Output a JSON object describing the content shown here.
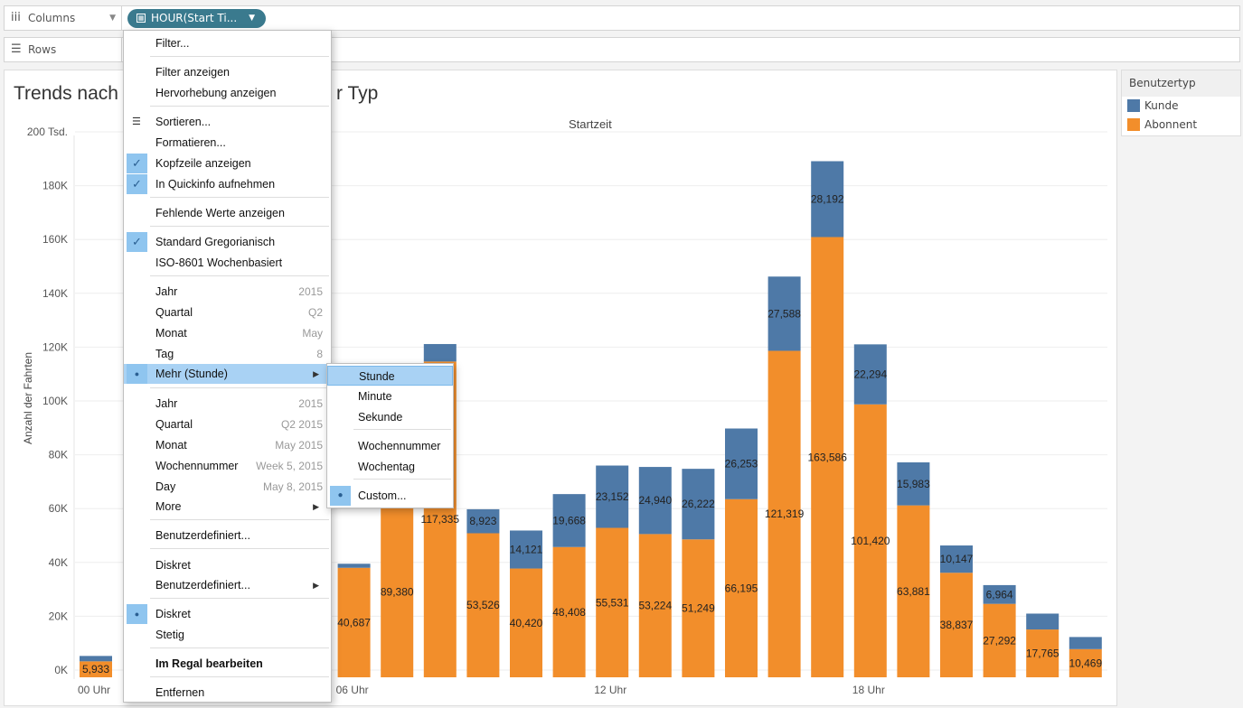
{
  "shelves": {
    "columns_label": "Columns",
    "rows_label": "Rows",
    "pill_label": "HOUR(Start Ti..."
  },
  "view": {
    "title_left": "Trends nach",
    "title_right": "r Typ",
    "header": "Startzeit"
  },
  "legend": {
    "title": "Benutzertyp",
    "items": [
      {
        "label": "Kunde",
        "color": "#4e79a7"
      },
      {
        "label": "Abonnent",
        "color": "#f28e2b"
      }
    ]
  },
  "menu": {
    "items": [
      {
        "label": "Filter..."
      },
      {
        "label": "Filter anzeigen"
      },
      {
        "label": "Hervorhebung anzeigen"
      },
      {
        "label": "Sortieren...",
        "icon": "sort-icon"
      },
      {
        "label": "Formatieren..."
      },
      {
        "label": "Kopfzeile anzeigen",
        "checked": true
      },
      {
        "label": "In Quickinfo aufnehmen",
        "checked": true
      },
      {
        "label": "Fehlende Werte anzeigen"
      },
      {
        "label": "Standard Gregorianisch",
        "checked": true
      },
      {
        "label": "ISO-8601 Wochenbasiert"
      },
      {
        "label": "Jahr",
        "value": "2015"
      },
      {
        "label": "Quartal",
        "value": "Q2"
      },
      {
        "label": "Monat",
        "value": "May"
      },
      {
        "label": "Tag",
        "value": "8"
      },
      {
        "label": "Mehr (Stunde)",
        "bullet": true,
        "submenu": true
      },
      {
        "label": "Jahr",
        "value": "2015"
      },
      {
        "label": "Quartal",
        "value": "Q2 2015"
      },
      {
        "label": "Monat",
        "value": "May 2015"
      },
      {
        "label": "Wochennummer",
        "value": "Week 5, 2015"
      },
      {
        "label": "Day",
        "value": "May 8, 2015"
      },
      {
        "label": "More",
        "submenu": true
      },
      {
        "label": "Benutzerdefiniert..."
      },
      {
        "label": "Diskret"
      },
      {
        "label": "Benutzerdefiniert...",
        "submenu": true
      },
      {
        "label": "Diskret",
        "bullet": true
      },
      {
        "label": "Stetig"
      },
      {
        "label": "Im Regal bearbeiten",
        "bold": true
      },
      {
        "label": "Entfernen"
      }
    ],
    "sub_items": [
      {
        "label": "Stunde"
      },
      {
        "label": "Minute"
      },
      {
        "label": "Sekunde"
      },
      {
        "label": "Wochennummer"
      },
      {
        "label": "Wochentag"
      },
      {
        "label": "Custom...",
        "bullet": true
      }
    ]
  },
  "chart_data": {
    "type": "bar",
    "stacked": true,
    "ylabel": "Anzahl der Fahrten",
    "ylim": [
      0,
      200000
    ],
    "yticks": [
      "0K",
      "20K",
      "40K",
      "60K",
      "80K",
      "100K",
      "120K",
      "140K",
      "160K",
      "180K",
      "200 Tsd."
    ],
    "x_tick_labels": [
      {
        "hour": 0,
        "label": "00 Uhr"
      },
      {
        "hour": 6,
        "label": "06 Uhr"
      },
      {
        "hour": 12,
        "label": "12 Uhr"
      },
      {
        "hour": 18,
        "label": "18 Uhr"
      }
    ],
    "categories": [
      0,
      1,
      2,
      3,
      4,
      5,
      6,
      7,
      8,
      9,
      10,
      11,
      12,
      13,
      14,
      15,
      16,
      17,
      18,
      19,
      20,
      21,
      22,
      23
    ],
    "series": [
      {
        "name": "Abonnent",
        "color": "#f28e2b",
        "values": [
          5933,
          null,
          null,
          null,
          null,
          null,
          40687,
          63500,
          117335,
          53526,
          40420,
          48408,
          55531,
          53224,
          51249,
          66195,
          121319,
          163586,
          101420,
          63881,
          38837,
          27292,
          17765,
          10469
        ],
        "labels": [
          "5,933",
          "",
          "",
          "",
          "",
          "",
          "40,687",
          "89,380",
          "117,335",
          "53,526",
          "40,420",
          "48,408",
          "55,531",
          "53,224",
          "51,249",
          "66,195",
          "121,319",
          "163,586",
          "101,420",
          "63,881",
          "38,837",
          "27,292",
          "17,765",
          "10,469"
        ]
      },
      {
        "name": "Kunde",
        "color": "#4e79a7",
        "values": [
          2000,
          null,
          null,
          null,
          null,
          null,
          1500,
          null,
          6500,
          8923,
          14121,
          19668,
          23152,
          24940,
          26222,
          26253,
          27588,
          28192,
          22294,
          15983,
          10147,
          6964,
          5900,
          4500
        ],
        "labels": [
          "",
          "",
          "",
          "",
          "",
          "",
          "",
          "",
          "",
          "8,923",
          "14,121",
          "19,668",
          "23,152",
          "24,940",
          "26,222",
          "26,253",
          "27,588",
          "28,192",
          "22,294",
          "15,983",
          "10,147",
          "6,964",
          "",
          ""
        ]
      }
    ]
  }
}
